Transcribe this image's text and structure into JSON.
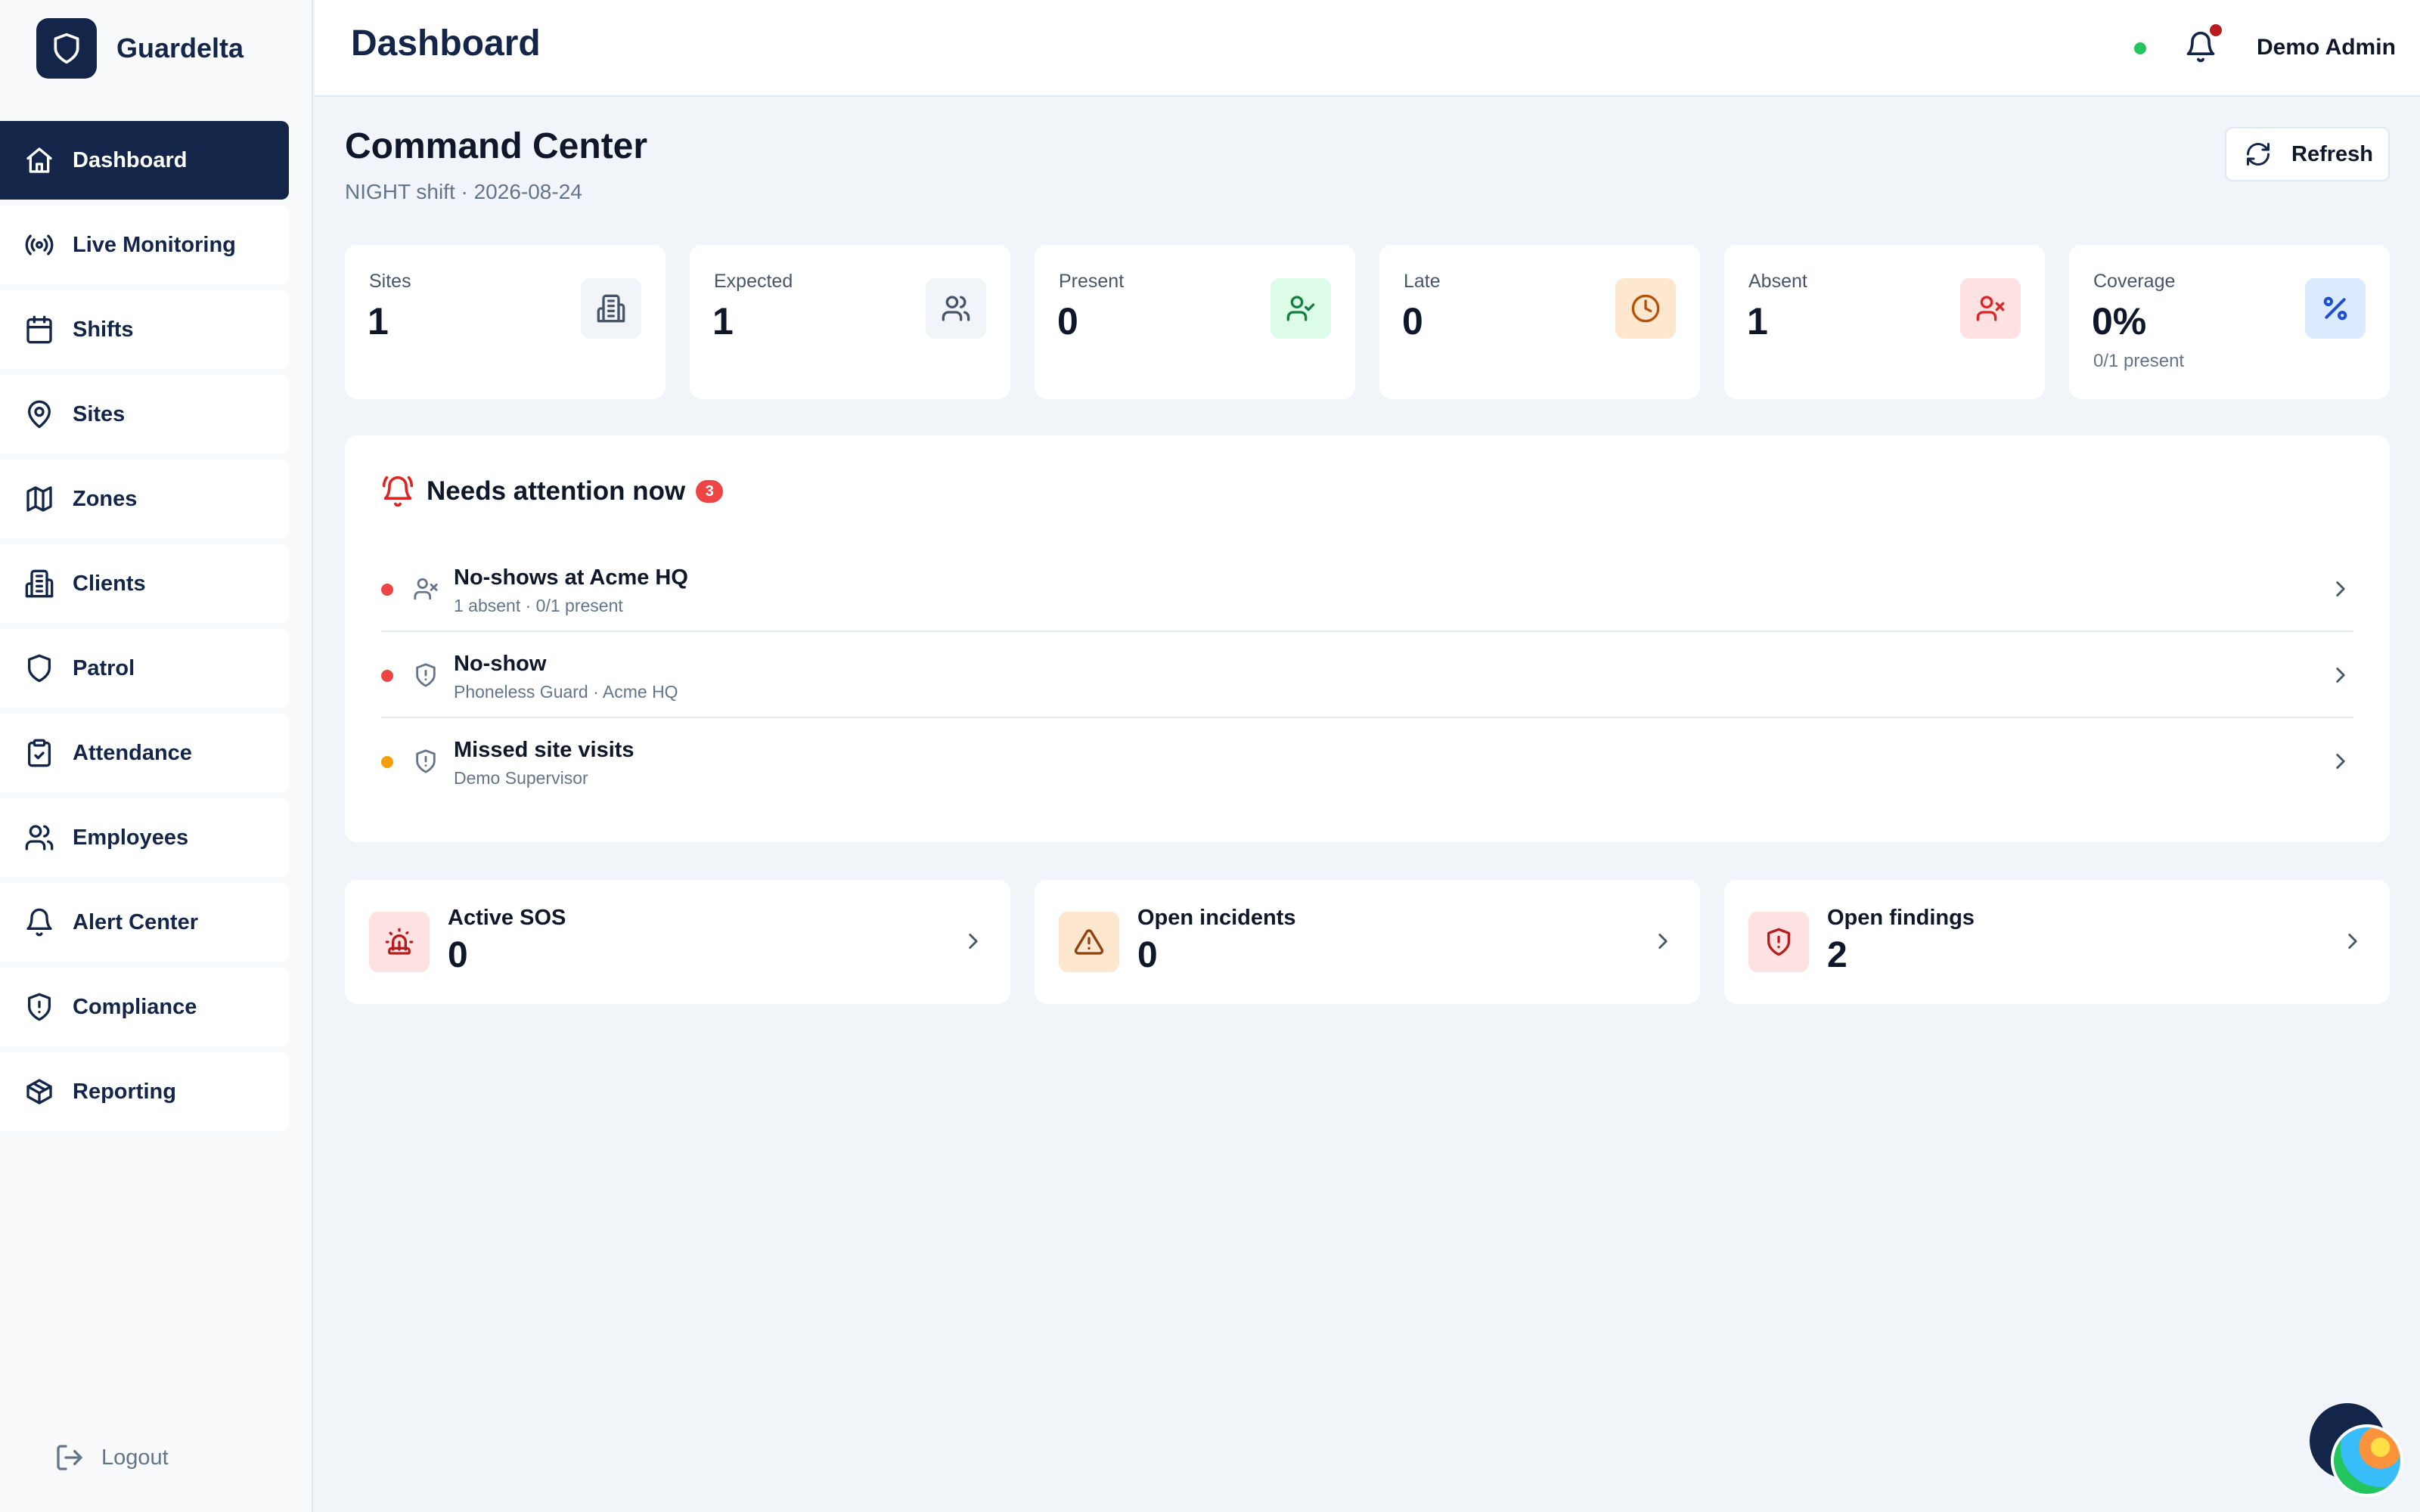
{
  "brand": {
    "name": "Guardelta"
  },
  "nav": {
    "items": [
      {
        "label": "Dashboard",
        "icon": "home-icon"
      },
      {
        "label": "Live Monitoring",
        "icon": "broadcast-icon"
      },
      {
        "label": "Shifts",
        "icon": "calendar-icon"
      },
      {
        "label": "Sites",
        "icon": "map-pin-icon"
      },
      {
        "label": "Zones",
        "icon": "map-icon"
      },
      {
        "label": "Clients",
        "icon": "building-icon"
      },
      {
        "label": "Patrol",
        "icon": "shield-icon"
      },
      {
        "label": "Attendance",
        "icon": "clipboard-check-icon"
      },
      {
        "label": "Employees",
        "icon": "users-icon"
      },
      {
        "label": "Alert Center",
        "icon": "bell-icon"
      },
      {
        "label": "Compliance",
        "icon": "shield-alert-icon"
      },
      {
        "label": "Reporting",
        "icon": "package-icon"
      }
    ],
    "active_index": 0,
    "logout_label": "Logout"
  },
  "header": {
    "title": "Dashboard",
    "user_name": "Demo Admin",
    "status_color": "#22c55e"
  },
  "command_center": {
    "title": "Command Center",
    "subtitle": "NIGHT shift · 2026-08-24",
    "refresh_label": "Refresh"
  },
  "stats": [
    {
      "label": "Sites",
      "value": "1",
      "hint": "",
      "icon": "building-icon",
      "icon_bg": "#f1f5f9",
      "icon_color": "#475569"
    },
    {
      "label": "Expected",
      "value": "1",
      "hint": "",
      "icon": "users-icon",
      "icon_bg": "#f1f5f9",
      "icon_color": "#475569"
    },
    {
      "label": "Present",
      "value": "0",
      "hint": "",
      "icon": "user-check-icon",
      "icon_bg": "#dcfce7",
      "icon_color": "#15803d"
    },
    {
      "label": "Late",
      "value": "0",
      "hint": "",
      "icon": "clock-icon",
      "icon_bg": "#fde7cf",
      "icon_color": "#b45309"
    },
    {
      "label": "Absent",
      "value": "1",
      "hint": "",
      "icon": "user-x-icon",
      "icon_bg": "#fee2e2",
      "icon_color": "#dc2626"
    },
    {
      "label": "Coverage",
      "value": "0%",
      "hint": "0/1 present",
      "icon": "percent-icon",
      "icon_bg": "#dbeafe",
      "icon_color": "#1d4ed8"
    }
  ],
  "attention": {
    "title": "Needs attention now",
    "count": "3",
    "items": [
      {
        "title": "No-shows at Acme HQ",
        "subtitle": "1 absent · 0/1 present",
        "severity_color": "#ef4444",
        "icon": "user-x-icon"
      },
      {
        "title": "No-show",
        "subtitle": "Phoneless Guard · Acme HQ",
        "severity_color": "#ef4444",
        "icon": "shield-alert-icon"
      },
      {
        "title": "Missed site visits",
        "subtitle": "Demo Supervisor",
        "severity_color": "#f59e0b",
        "icon": "shield-alert-icon"
      }
    ]
  },
  "summaries": [
    {
      "label": "Active SOS",
      "value": "0",
      "icon": "siren-icon",
      "icon_bg": "#fee2e2",
      "icon_color": "#b91c1c"
    },
    {
      "label": "Open incidents",
      "value": "0",
      "icon": "warning-icon",
      "icon_bg": "#fde7cf",
      "icon_color": "#92400e"
    },
    {
      "label": "Open findings",
      "value": "2",
      "icon": "shield-alert-icon",
      "icon_bg": "#fee2e2",
      "icon_color": "#b91c1c"
    }
  ]
}
